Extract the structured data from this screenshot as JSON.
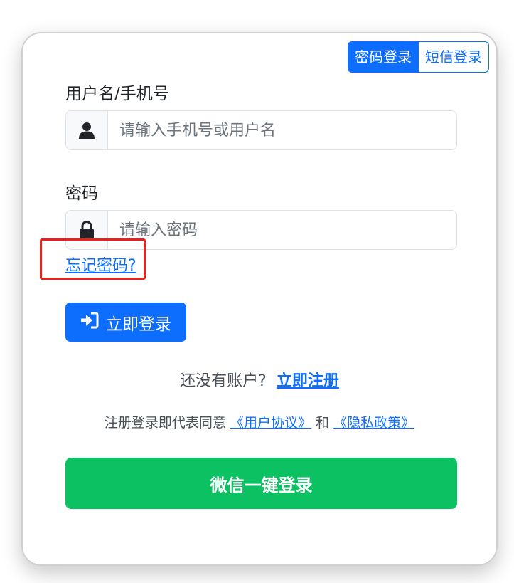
{
  "tabs": {
    "password_login": "密码登录",
    "sms_login": "短信登录"
  },
  "username": {
    "label": "用户名/手机号",
    "placeholder": "请输入手机号或用户名",
    "icon": "user-icon"
  },
  "password": {
    "label": "密码",
    "placeholder": "请输入密码",
    "icon": "lock-icon"
  },
  "forgot_password": "忘记密码?",
  "login_button": {
    "label": "立即登录",
    "icon": "sign-in-icon"
  },
  "signup": {
    "prompt": "还没有账户?",
    "link": "立即注册"
  },
  "terms": {
    "prefix": "注册登录即代表同意",
    "user_agreement": "《用户协议》",
    "conjunction": "和",
    "privacy_policy": "《隐私政策》"
  },
  "wechat_button": "微信一键登录",
  "colors": {
    "primary": "#0d6efd",
    "wechat": "#0cc162",
    "highlight": "#e8221b"
  }
}
